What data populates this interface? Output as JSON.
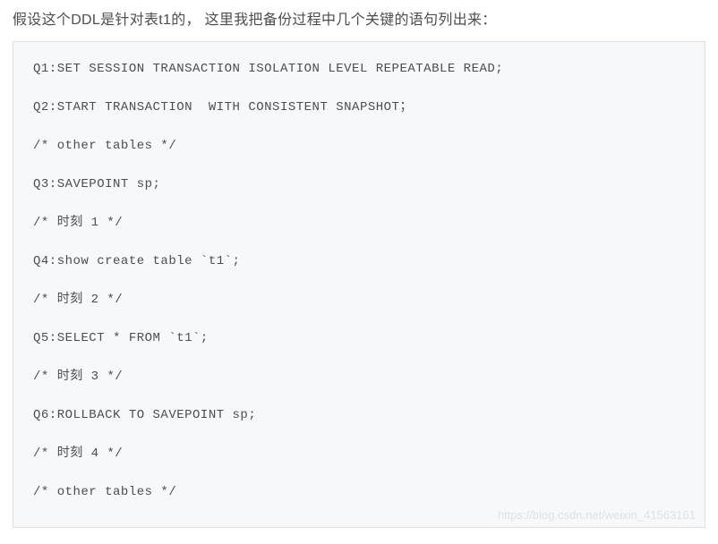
{
  "intro": "假设这个DDL是针对表t1的，  这里我把备份过程中几个关键的语句列出来：",
  "code": {
    "lines": [
      "Q1:SET SESSION TRANSACTION ISOLATION LEVEL REPEATABLE READ;",
      "Q2:START TRANSACTION  WITH CONSISTENT SNAPSHOT；",
      "/* other tables */",
      "Q3:SAVEPOINT sp;",
      "/* 时刻 1 */",
      "Q4:show create table `t1`;",
      "/* 时刻 2 */",
      "Q5:SELECT * FROM `t1`;",
      "/* 时刻 3 */",
      "Q6:ROLLBACK TO SAVEPOINT sp;",
      "/* 时刻 4 */",
      "/* other tables */"
    ]
  },
  "watermark": "https://blog.csdn.net/weixin_41563161"
}
